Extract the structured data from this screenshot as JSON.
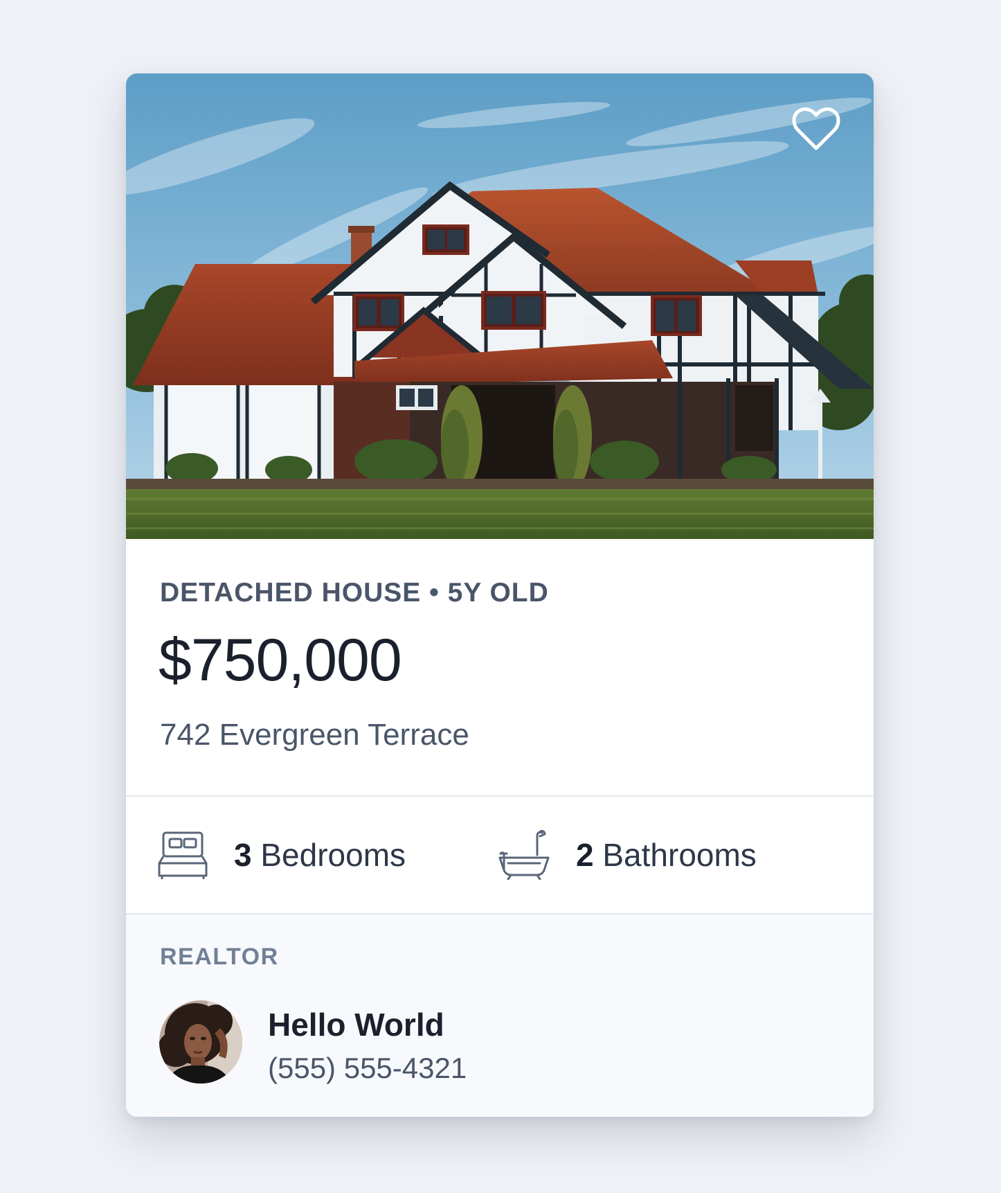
{
  "listing": {
    "favorite_icon": "heart-icon",
    "photo_subject": "house-photo",
    "property_type": "DETACHED HOUSE • 5Y OLD",
    "price": "$750,000",
    "address": "742 Evergreen Terrace"
  },
  "specs": {
    "bedrooms": {
      "count": "3",
      "label": " Bedrooms",
      "icon": "bed-icon"
    },
    "bathrooms": {
      "count": "2",
      "label": " Bathrooms",
      "icon": "bathtub-icon"
    }
  },
  "realtor": {
    "section_label": "REALTOR",
    "name": "Hello World",
    "phone": "(555) 555-4321",
    "avatar_icon": "realtor-avatar"
  },
  "colors": {
    "page_background": "#eef1f6",
    "card_background": "#ffffff",
    "footer_background": "#f7f9fc",
    "heading_text": "#1a202c",
    "body_text": "#4a5568",
    "muted_text": "#718096",
    "divider": "#e2e8f0"
  }
}
